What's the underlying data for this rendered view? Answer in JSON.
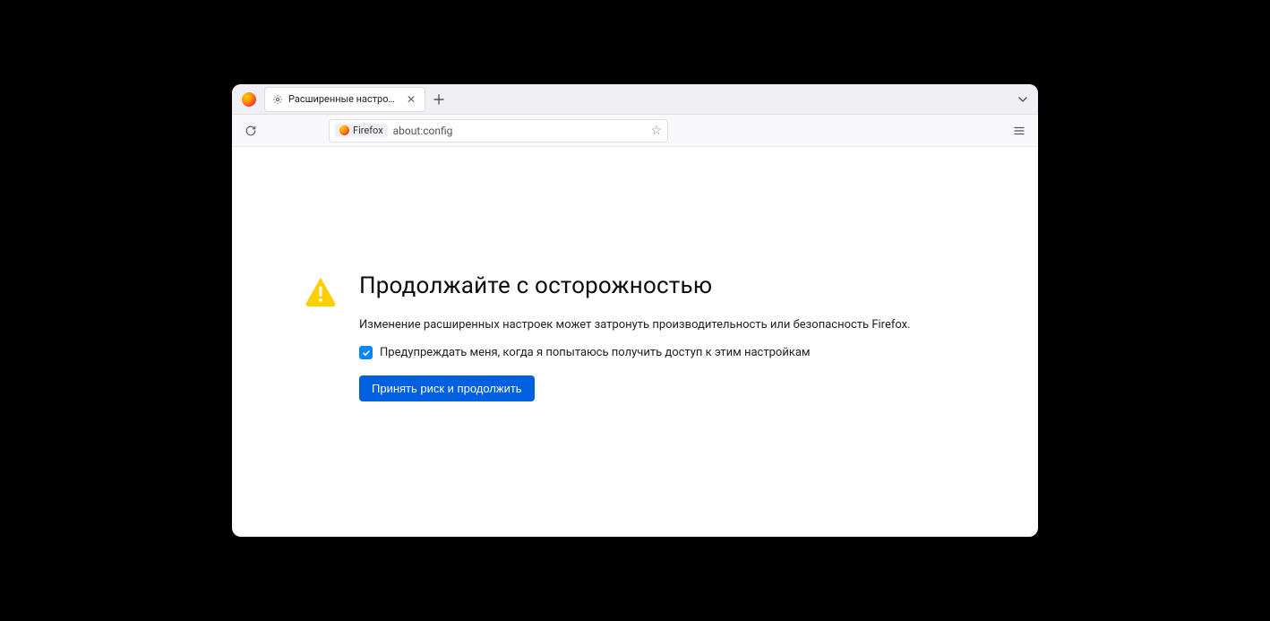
{
  "tab": {
    "title": "Расширенные настройки"
  },
  "urlbar": {
    "identity_label": "Firefox",
    "url": "about:config"
  },
  "page": {
    "heading": "Продолжайте с осторожностью",
    "description": "Изменение расширенных настроек может затронуть производительность или безопасность Firefox.",
    "checkbox_label": "Предупреждать меня, когда я попытаюсь получить доступ к этим настройкам",
    "checkbox_checked": true,
    "accept_button": "Принять риск и продолжить"
  }
}
